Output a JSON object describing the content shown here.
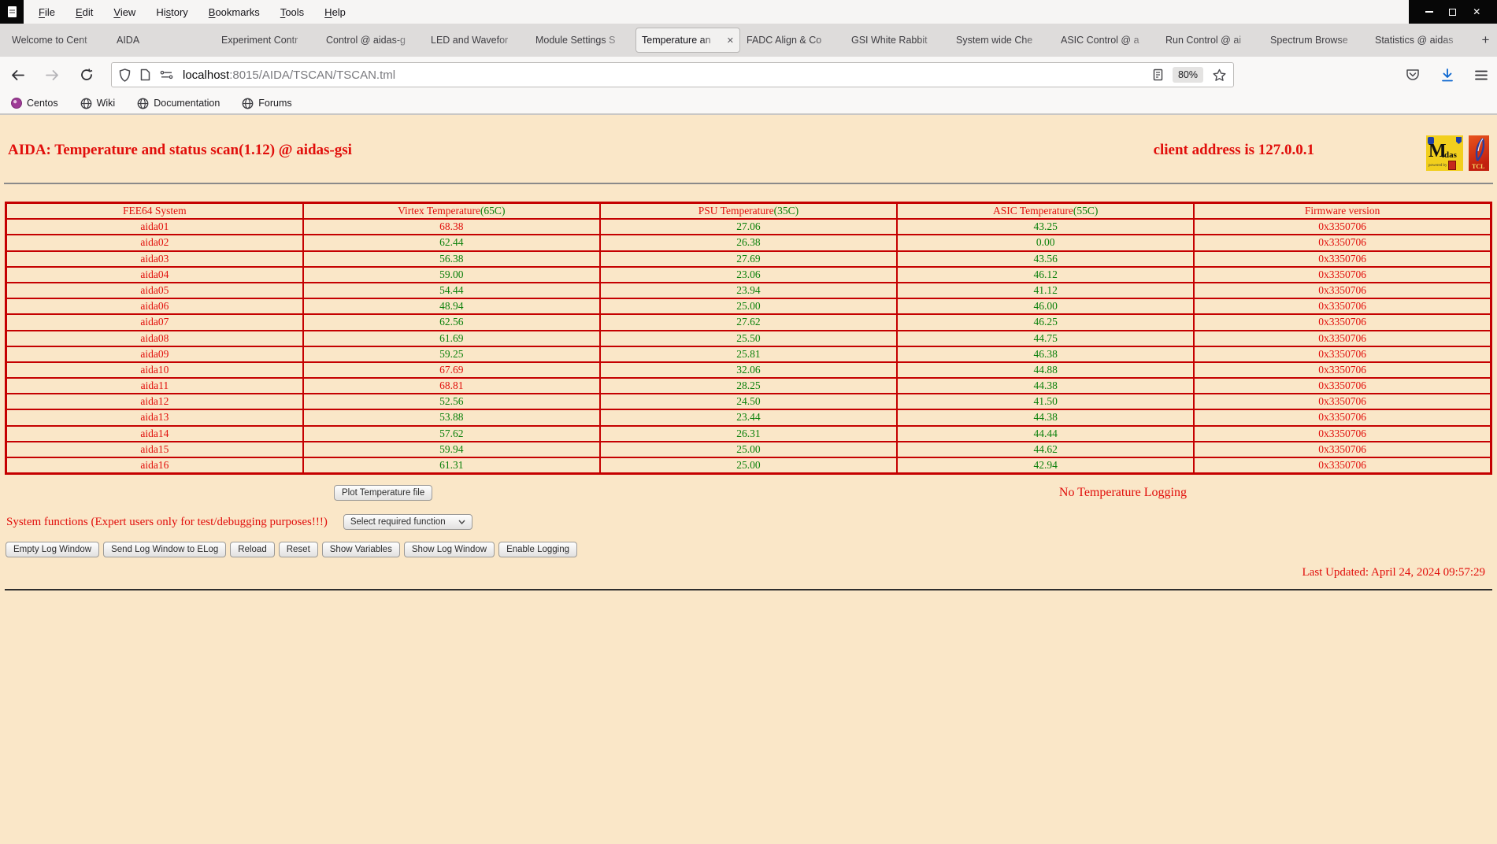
{
  "menubar": {
    "items": [
      {
        "label": "File",
        "accel": 0
      },
      {
        "label": "Edit",
        "accel": 0
      },
      {
        "label": "View",
        "accel": 0
      },
      {
        "label": "History",
        "accel": 2
      },
      {
        "label": "Bookmarks",
        "accel": 0
      },
      {
        "label": "Tools",
        "accel": 0
      },
      {
        "label": "Help",
        "accel": 0
      }
    ]
  },
  "tabs": {
    "active_index": 6,
    "new_tab_label": "+",
    "items": [
      {
        "label": "Welcome to Cent"
      },
      {
        "label": "AIDA"
      },
      {
        "label": "Experiment Contr"
      },
      {
        "label": "Control @ aidas-g"
      },
      {
        "label": "LED and Wavefor"
      },
      {
        "label": "Module Settings S"
      },
      {
        "label": "Temperature an"
      },
      {
        "label": "FADC Align & Co"
      },
      {
        "label": "GSI White Rabbit"
      },
      {
        "label": "System wide Che"
      },
      {
        "label": "ASIC Control @ a"
      },
      {
        "label": "Run Control @ ai"
      },
      {
        "label": "Spectrum Browse"
      },
      {
        "label": "Statistics @ aidas"
      }
    ]
  },
  "urlbar": {
    "host": "localhost",
    "path": ":8015/AIDA/TSCAN/TSCAN.tml",
    "zoom_badge": "80%"
  },
  "bookmarks": [
    {
      "label": "Centos",
      "icon": "centos-icon"
    },
    {
      "label": "Wiki",
      "icon": "globe-icon"
    },
    {
      "label": "Documentation",
      "icon": "globe-icon"
    },
    {
      "label": "Forums",
      "icon": "globe-icon"
    }
  ],
  "page": {
    "title": "AIDA: Temperature and status scan(1.12) @ aidas-gsi",
    "client_address": "client address is 127.0.0.1",
    "logos": {
      "midas_m": "M",
      "midas_rest": "idas",
      "midas_powered": "powered by",
      "tcl": "TCL"
    },
    "table": {
      "headers": [
        {
          "label": "FEE64 System"
        },
        {
          "label": "Virtex Temperature",
          "limit_label": "(65C)",
          "limit": 65
        },
        {
          "label": "PSU Temperature",
          "limit_label": "(35C)",
          "limit": 35
        },
        {
          "label": "ASIC Temperature",
          "limit_label": "(55C)",
          "limit": 55
        },
        {
          "label": "Firmware version"
        }
      ],
      "rows": [
        {
          "name": "aida01",
          "virtex": "68.38",
          "psu": "27.06",
          "asic": "43.25",
          "firmware": "0x3350706"
        },
        {
          "name": "aida02",
          "virtex": "62.44",
          "psu": "26.38",
          "asic": "0.00",
          "firmware": "0x3350706"
        },
        {
          "name": "aida03",
          "virtex": "56.38",
          "psu": "27.69",
          "asic": "43.56",
          "firmware": "0x3350706"
        },
        {
          "name": "aida04",
          "virtex": "59.00",
          "psu": "23.06",
          "asic": "46.12",
          "firmware": "0x3350706"
        },
        {
          "name": "aida05",
          "virtex": "54.44",
          "psu": "23.94",
          "asic": "41.12",
          "firmware": "0x3350706"
        },
        {
          "name": "aida06",
          "virtex": "48.94",
          "psu": "25.00",
          "asic": "46.00",
          "firmware": "0x3350706"
        },
        {
          "name": "aida07",
          "virtex": "62.56",
          "psu": "27.62",
          "asic": "46.25",
          "firmware": "0x3350706"
        },
        {
          "name": "aida08",
          "virtex": "61.69",
          "psu": "25.50",
          "asic": "44.75",
          "firmware": "0x3350706"
        },
        {
          "name": "aida09",
          "virtex": "59.25",
          "psu": "25.81",
          "asic": "46.38",
          "firmware": "0x3350706"
        },
        {
          "name": "aida10",
          "virtex": "67.69",
          "psu": "32.06",
          "asic": "44.88",
          "firmware": "0x3350706"
        },
        {
          "name": "aida11",
          "virtex": "68.81",
          "psu": "28.25",
          "asic": "44.38",
          "firmware": "0x3350706"
        },
        {
          "name": "aida12",
          "virtex": "52.56",
          "psu": "24.50",
          "asic": "41.50",
          "firmware": "0x3350706"
        },
        {
          "name": "aida13",
          "virtex": "53.88",
          "psu": "23.44",
          "asic": "44.38",
          "firmware": "0x3350706"
        },
        {
          "name": "aida14",
          "virtex": "57.62",
          "psu": "26.31",
          "asic": "44.44",
          "firmware": "0x3350706"
        },
        {
          "name": "aida15",
          "virtex": "59.94",
          "psu": "25.00",
          "asic": "44.62",
          "firmware": "0x3350706"
        },
        {
          "name": "aida16",
          "virtex": "61.31",
          "psu": "25.00",
          "asic": "42.94",
          "firmware": "0x3350706"
        }
      ]
    },
    "plot_button_label": "Plot Temperature file",
    "logging_status": "No Temperature Logging",
    "system_functions_label": "System functions (Expert users only for test/debugging purposes!!!)",
    "function_select_value": "Select required function",
    "action_buttons": [
      {
        "name": "empty-log-window-button",
        "label": "Empty Log Window"
      },
      {
        "name": "send-log-to-elog-button",
        "label": "Send Log Window to ELog"
      },
      {
        "name": "reload-button",
        "label": "Reload"
      },
      {
        "name": "reset-button",
        "label": "Reset"
      },
      {
        "name": "show-variables-button",
        "label": "Show Variables"
      },
      {
        "name": "show-log-window-button",
        "label": "Show Log Window"
      },
      {
        "name": "enable-logging-button",
        "label": "Enable Logging"
      }
    ],
    "last_updated": "Last Updated: April 24, 2024 09:57:29"
  }
}
